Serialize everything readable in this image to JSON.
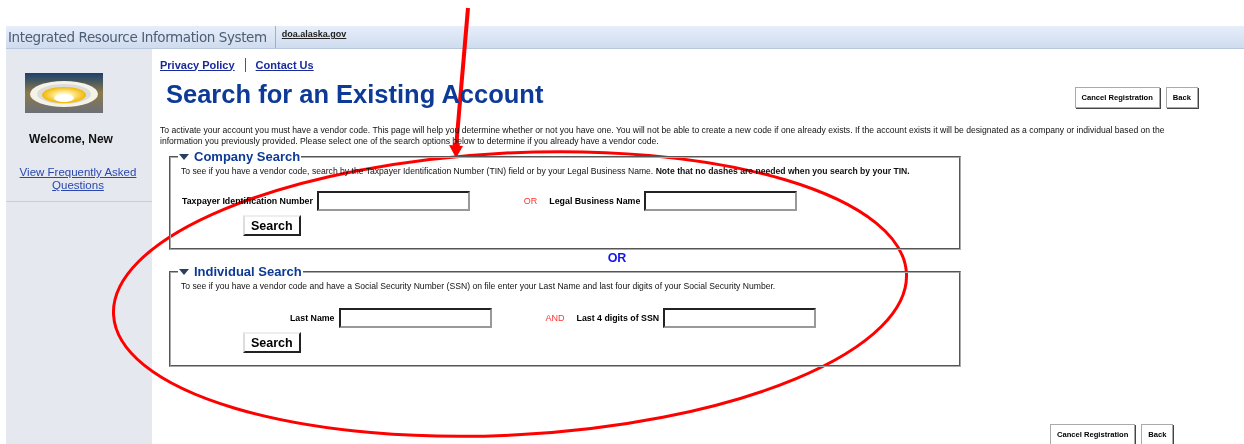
{
  "header": {
    "title": "Integrated Resource Information System",
    "link": "doa.alaska.gov"
  },
  "sidebar": {
    "welcome": "Welcome, New",
    "faq_link": "View Frequently Asked Questions"
  },
  "top_links": [
    "Privacy Policy",
    "Contact Us"
  ],
  "page_title": "Search for an Existing Account",
  "top_buttons": [
    "Cancel Registration",
    "Back"
  ],
  "intro": "To activate your account you must have a vendor code. This page will help you determine whether or not you have one. You will not be able to create a new code if one already exists. If the account exists it will be designated as a company or individual based on the information you previously provided. Please select one of the search options below to determine if you already have a vendor code.",
  "sections": [
    {
      "title": "Company Search",
      "expanded": true,
      "description": "To see if you have a vendor code, search by the Taxpayer Identification Number (TIN) field or by your Legal Business Name. **Note that no dashes are needed when you search by your TIN.**",
      "fields": [
        {
          "label": "Taxpayer Identification Number"
        },
        {
          "label": "Legal Business Name"
        }
      ],
      "connector": "OR",
      "button": "Search"
    },
    {
      "title": "Individual Search",
      "expanded": true,
      "description": "To see if you have a vendor code and have a Social Security Number (SSN) on file enter your Last Name and last four digits of your Social Security Number.",
      "fields": [
        {
          "label": "Last Name"
        },
        {
          "label": "Last 4 digits of SSN"
        }
      ],
      "connector": "AND",
      "button": "Search"
    }
  ],
  "between": "OR",
  "bottom_buttons": [
    "Cancel Registration",
    "Back"
  ]
}
